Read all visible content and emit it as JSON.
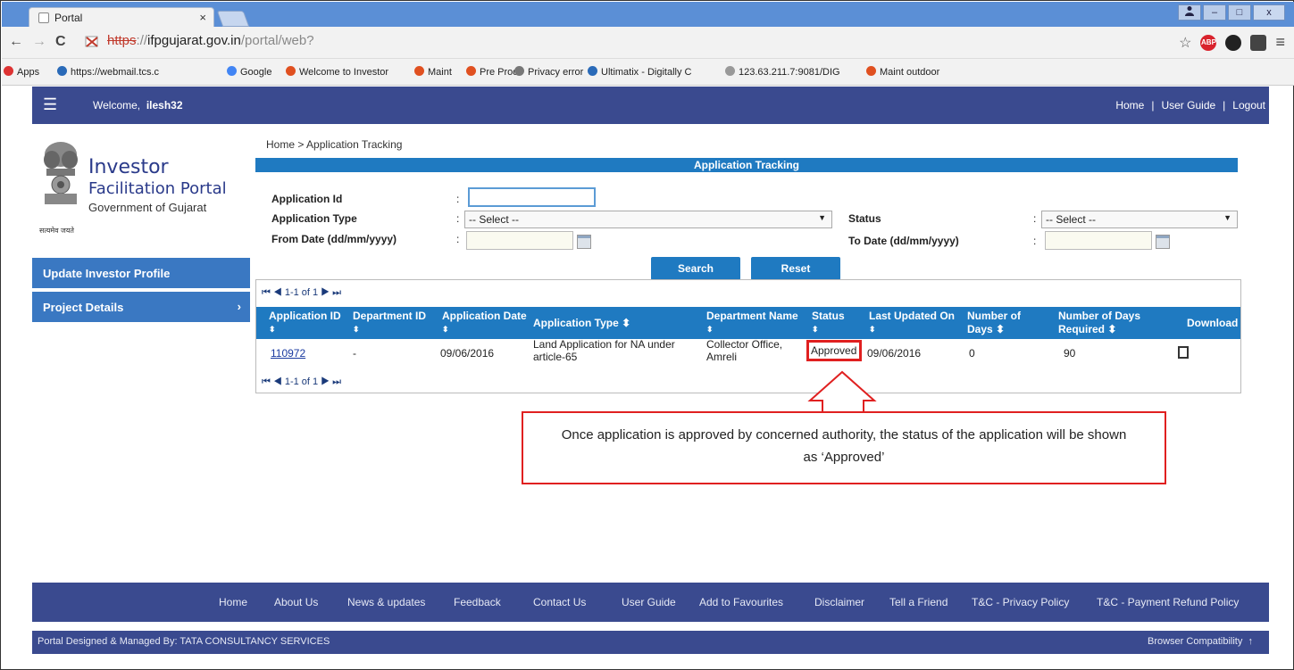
{
  "browser": {
    "tab_title": "Portal",
    "tab_close": "×",
    "url_scheme": "https",
    "url_sep": "://",
    "url_host": "ifpgujarat.gov.in",
    "url_path": "/portal/web?",
    "window_buttons": [
      "–",
      "□",
      "x"
    ],
    "nav_back": "←",
    "nav_forward": "→",
    "nav_reload": "C",
    "menu_icon": "≡",
    "star_icon": "☆",
    "abp_label": "ABP"
  },
  "bookmarks": [
    {
      "label": "Apps",
      "color": "#d33"
    },
    {
      "label": "https://webmail.tcs.c",
      "color": "#2a6ab8"
    },
    {
      "label": "Google",
      "color": "#4285f4"
    },
    {
      "label": "Welcome to Investor",
      "color": "#e05020"
    },
    {
      "label": "Maint",
      "color": "#e05020"
    },
    {
      "label": "Pre Prod",
      "color": "#e05020"
    },
    {
      "label": "Privacy error",
      "color": "#777"
    },
    {
      "label": "Ultimatix - Digitally C",
      "color": "#2a6ab8"
    },
    {
      "label": "123.63.211.7:9081/DIG",
      "color": "#999"
    },
    {
      "label": "Maint outdoor",
      "color": "#e05020"
    }
  ],
  "header": {
    "welcome_prefix": "Welcome,",
    "username": "ilesh32",
    "links": [
      "Home",
      "User Guide",
      "Logout"
    ],
    "separator": "|"
  },
  "logo": {
    "line1": "Investor",
    "line2": "Facilitation Portal",
    "line3": "Government of Gujarat",
    "line4": "सत्यमेव जयते"
  },
  "sidebar": {
    "items": [
      {
        "label": "Update Investor Profile",
        "chevron": ""
      },
      {
        "label": "Project Details",
        "chevron": "›"
      }
    ]
  },
  "breadcrumb": {
    "home": "Home",
    "sep": ">",
    "current": "Application Tracking"
  },
  "panel": {
    "title": "Application Tracking"
  },
  "form": {
    "application_id_label": "Application Id",
    "application_type_label": "Application Type",
    "from_date_label": "From Date (dd/mm/yyyy)",
    "status_label": "Status",
    "to_date_label": "To Date (dd/mm/yyyy)",
    "colon": ":",
    "application_type_value": "-- Select --",
    "status_value": "-- Select --",
    "application_id_value": "",
    "from_date_value": "",
    "to_date_value": "",
    "search_button": "Search",
    "reset_button": "Reset"
  },
  "pager": {
    "first": "⏮",
    "prev": "◀",
    "text": "1-1 of 1",
    "next": "▶",
    "last": "⏭"
  },
  "table": {
    "columns": [
      {
        "l1": "Application ID",
        "l2": "⬍"
      },
      {
        "l1": "Department ID",
        "l2": "⬍"
      },
      {
        "l1": "Application Date",
        "l2": "⬍"
      },
      {
        "l1": "Application Type ⬍",
        "l2": ""
      },
      {
        "l1": "Department Name",
        "l2": "⬍"
      },
      {
        "l1": "Status",
        "l2": "⬍"
      },
      {
        "l1": "Last Updated On",
        "l2": "⬍"
      },
      {
        "l1": "Number of",
        "l2": "Days ⬍"
      },
      {
        "l1": "Number of Days",
        "l2": "Required ⬍"
      },
      {
        "l1": "Download",
        "l2": ""
      }
    ],
    "rows": [
      {
        "application_id": "110972",
        "department_id": "-",
        "application_date": "09/06/2016",
        "application_type_l1": "Land Application for NA under",
        "application_type_l2": "article-65",
        "department_name_l1": "Collector Office,",
        "department_name_l2": "Amreli",
        "status": "Approved",
        "last_updated_on": "09/06/2016",
        "number_of_days": "0",
        "number_of_days_required": "90"
      }
    ]
  },
  "callout": {
    "text": "Once application is approved by concerned authority, the status of the application will be shown as ‘Approved’",
    "border_color": "#e02020"
  },
  "footer": {
    "links": [
      "Home",
      "About Us",
      "News & updates",
      "Feedback",
      "Contact Us",
      "User Guide",
      "Add to Favourites",
      "Disclaimer",
      "Tell a Friend",
      "T&C - Privacy Policy",
      "T&C - Payment Refund Policy"
    ],
    "designed_by": "Portal Designed & Managed By: TATA CONSULTANCY SERVICES",
    "browser_compat": "Browser Compatibility",
    "up_arrow": "↑"
  },
  "colors": {
    "brand_navy": "#3a4a8f",
    "accent_blue": "#1f7ac1",
    "sidebar_blue": "#3a78c2",
    "highlight_red": "#e02020"
  }
}
